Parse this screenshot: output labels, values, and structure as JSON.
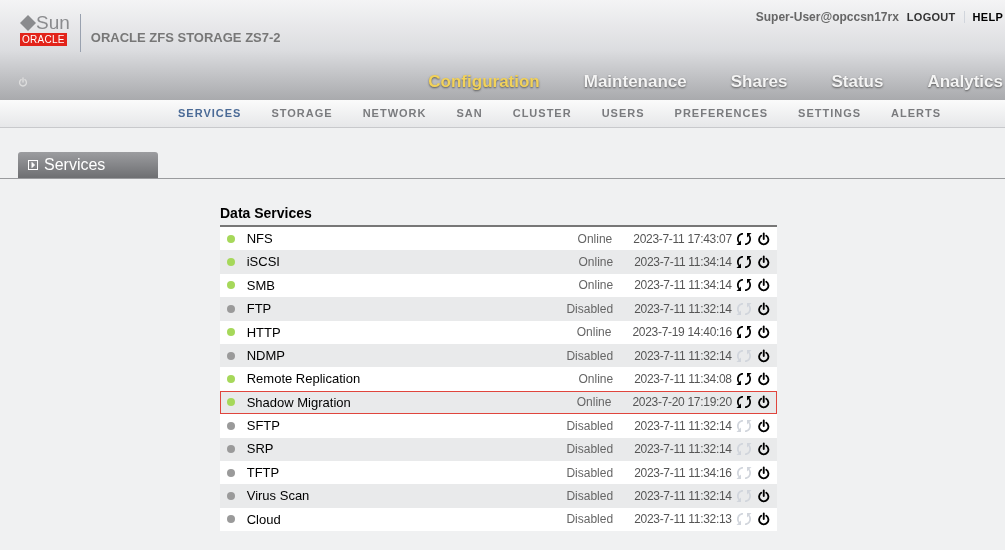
{
  "header": {
    "logo_top": "Sun",
    "logo_bottom": "ORACLE",
    "product": "ORACLE ZFS STORAGE ZS7-2",
    "user": "Super-User@opccsn17rx",
    "links": [
      "LOGOUT",
      "HELP"
    ]
  },
  "main_nav": [
    {
      "label": "Configuration",
      "selected": true
    },
    {
      "label": "Maintenance",
      "selected": false
    },
    {
      "label": "Shares",
      "selected": false
    },
    {
      "label": "Status",
      "selected": false
    },
    {
      "label": "Analytics",
      "selected": false
    }
  ],
  "sub_nav": [
    {
      "label": "SERVICES",
      "selected": true
    },
    {
      "label": "STORAGE",
      "selected": false
    },
    {
      "label": "NETWORK",
      "selected": false
    },
    {
      "label": "SAN",
      "selected": false
    },
    {
      "label": "CLUSTER",
      "selected": false
    },
    {
      "label": "USERS",
      "selected": false
    },
    {
      "label": "PREFERENCES",
      "selected": false
    },
    {
      "label": "SETTINGS",
      "selected": false
    },
    {
      "label": "ALERTS",
      "selected": false
    }
  ],
  "section_tab": "Services",
  "table": {
    "title": "Data Services",
    "rows": [
      {
        "name": "NFS",
        "status": "Online",
        "online": true,
        "time": "2023-7-11 17:43:07",
        "selected": false
      },
      {
        "name": "iSCSI",
        "status": "Online",
        "online": true,
        "time": "2023-7-11 11:34:14",
        "selected": false
      },
      {
        "name": "SMB",
        "status": "Online",
        "online": true,
        "time": "2023-7-11 11:34:14",
        "selected": false
      },
      {
        "name": "FTP",
        "status": "Disabled",
        "online": false,
        "time": "2023-7-11 11:32:14",
        "selected": false
      },
      {
        "name": "HTTP",
        "status": "Online",
        "online": true,
        "time": "2023-7-19 14:40:16",
        "selected": false
      },
      {
        "name": "NDMP",
        "status": "Disabled",
        "online": false,
        "time": "2023-7-11 11:32:14",
        "selected": false
      },
      {
        "name": "Remote Replication",
        "status": "Online",
        "online": true,
        "time": "2023-7-11 11:34:08",
        "selected": false
      },
      {
        "name": "Shadow Migration",
        "status": "Online",
        "online": true,
        "time": "2023-7-20 17:19:20",
        "selected": true
      },
      {
        "name": "SFTP",
        "status": "Disabled",
        "online": false,
        "time": "2023-7-11 11:32:14",
        "selected": false
      },
      {
        "name": "SRP",
        "status": "Disabled",
        "online": false,
        "time": "2023-7-11 11:32:14",
        "selected": false
      },
      {
        "name": "TFTP",
        "status": "Disabled",
        "online": false,
        "time": "2023-7-11 11:34:16",
        "selected": false
      },
      {
        "name": "Virus Scan",
        "status": "Disabled",
        "online": false,
        "time": "2023-7-11 11:32:14",
        "selected": false
      },
      {
        "name": "Cloud",
        "status": "Disabled",
        "online": false,
        "time": "2023-7-11 11:32:13",
        "selected": false
      }
    ]
  }
}
